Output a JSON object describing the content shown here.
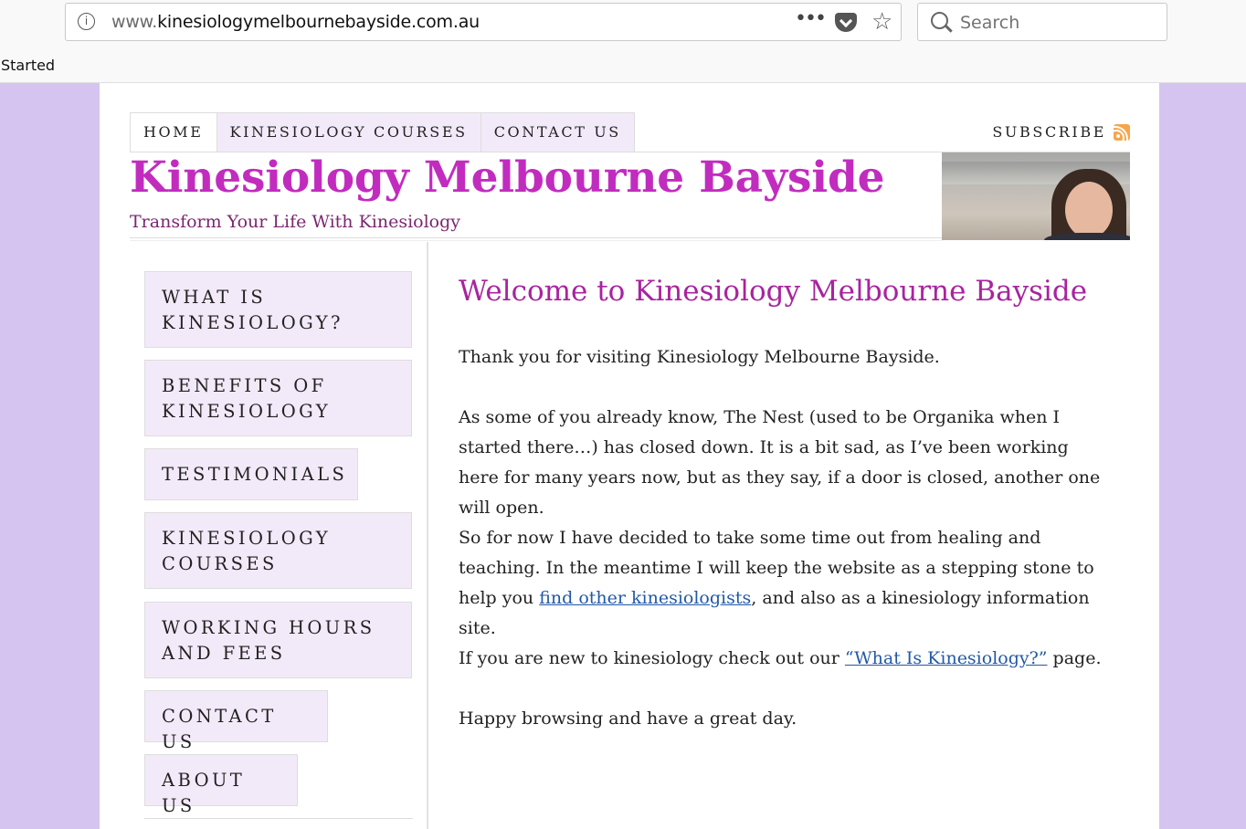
{
  "browser": {
    "url_prefix": "www.",
    "url_domain": "kinesiologymelbournebayside.com.au",
    "search_placeholder": "Search",
    "status_text": "Started",
    "more_icon": "•••"
  },
  "topnav": {
    "tabs": [
      "HOME",
      "KINESIOLOGY COURSES",
      "CONTACT US"
    ],
    "active": "HOME",
    "subscribe": "SUBSCRIBE"
  },
  "header": {
    "title": "Kinesiology Melbourne Bayside",
    "tagline": "Transform Your Life With Kinesiology"
  },
  "sidebar": {
    "items": [
      "WHAT IS\nKINESIOLOGY?",
      "BENEFITS OF\nKINESIOLOGY",
      "TESTIMONIALS",
      "KINESIOLOGY\nCOURSES",
      "WORKING HOURS\nAND FEES",
      "CONTACT US",
      "ABOUT US"
    ]
  },
  "main": {
    "heading": "Welcome to Kinesiology Melbourne Bayside",
    "p1": "Thank you for visiting Kinesiology Melbourne Bayside.",
    "p2": "As some of you already know, The Nest (used to be Organika when I started there…) has closed down. It is a bit sad, as I’ve been working here for many years now, but as they say, if a door is closed, another one will open.",
    "p3_before": "So for now I have decided to take some time out from healing and teaching. In the meantime I will keep the website as a stepping stone to help you ",
    "p3_link": "find other kinesiologists",
    "p3_after": ", and also as a kinesiology information site.",
    "p4_before": "If you are new to kinesiology check out our ",
    "p4_link": "“What Is Kinesiology?”",
    "p4_after": " page.",
    "p5": "Happy browsing and have a great day."
  },
  "colors": {
    "page_background": "#d5c3f0",
    "title": "#c12cbf",
    "tagline": "#7c2670",
    "heading": "#a8249f",
    "nav_background": "#f3eaf9",
    "link": "#2158a8"
  }
}
